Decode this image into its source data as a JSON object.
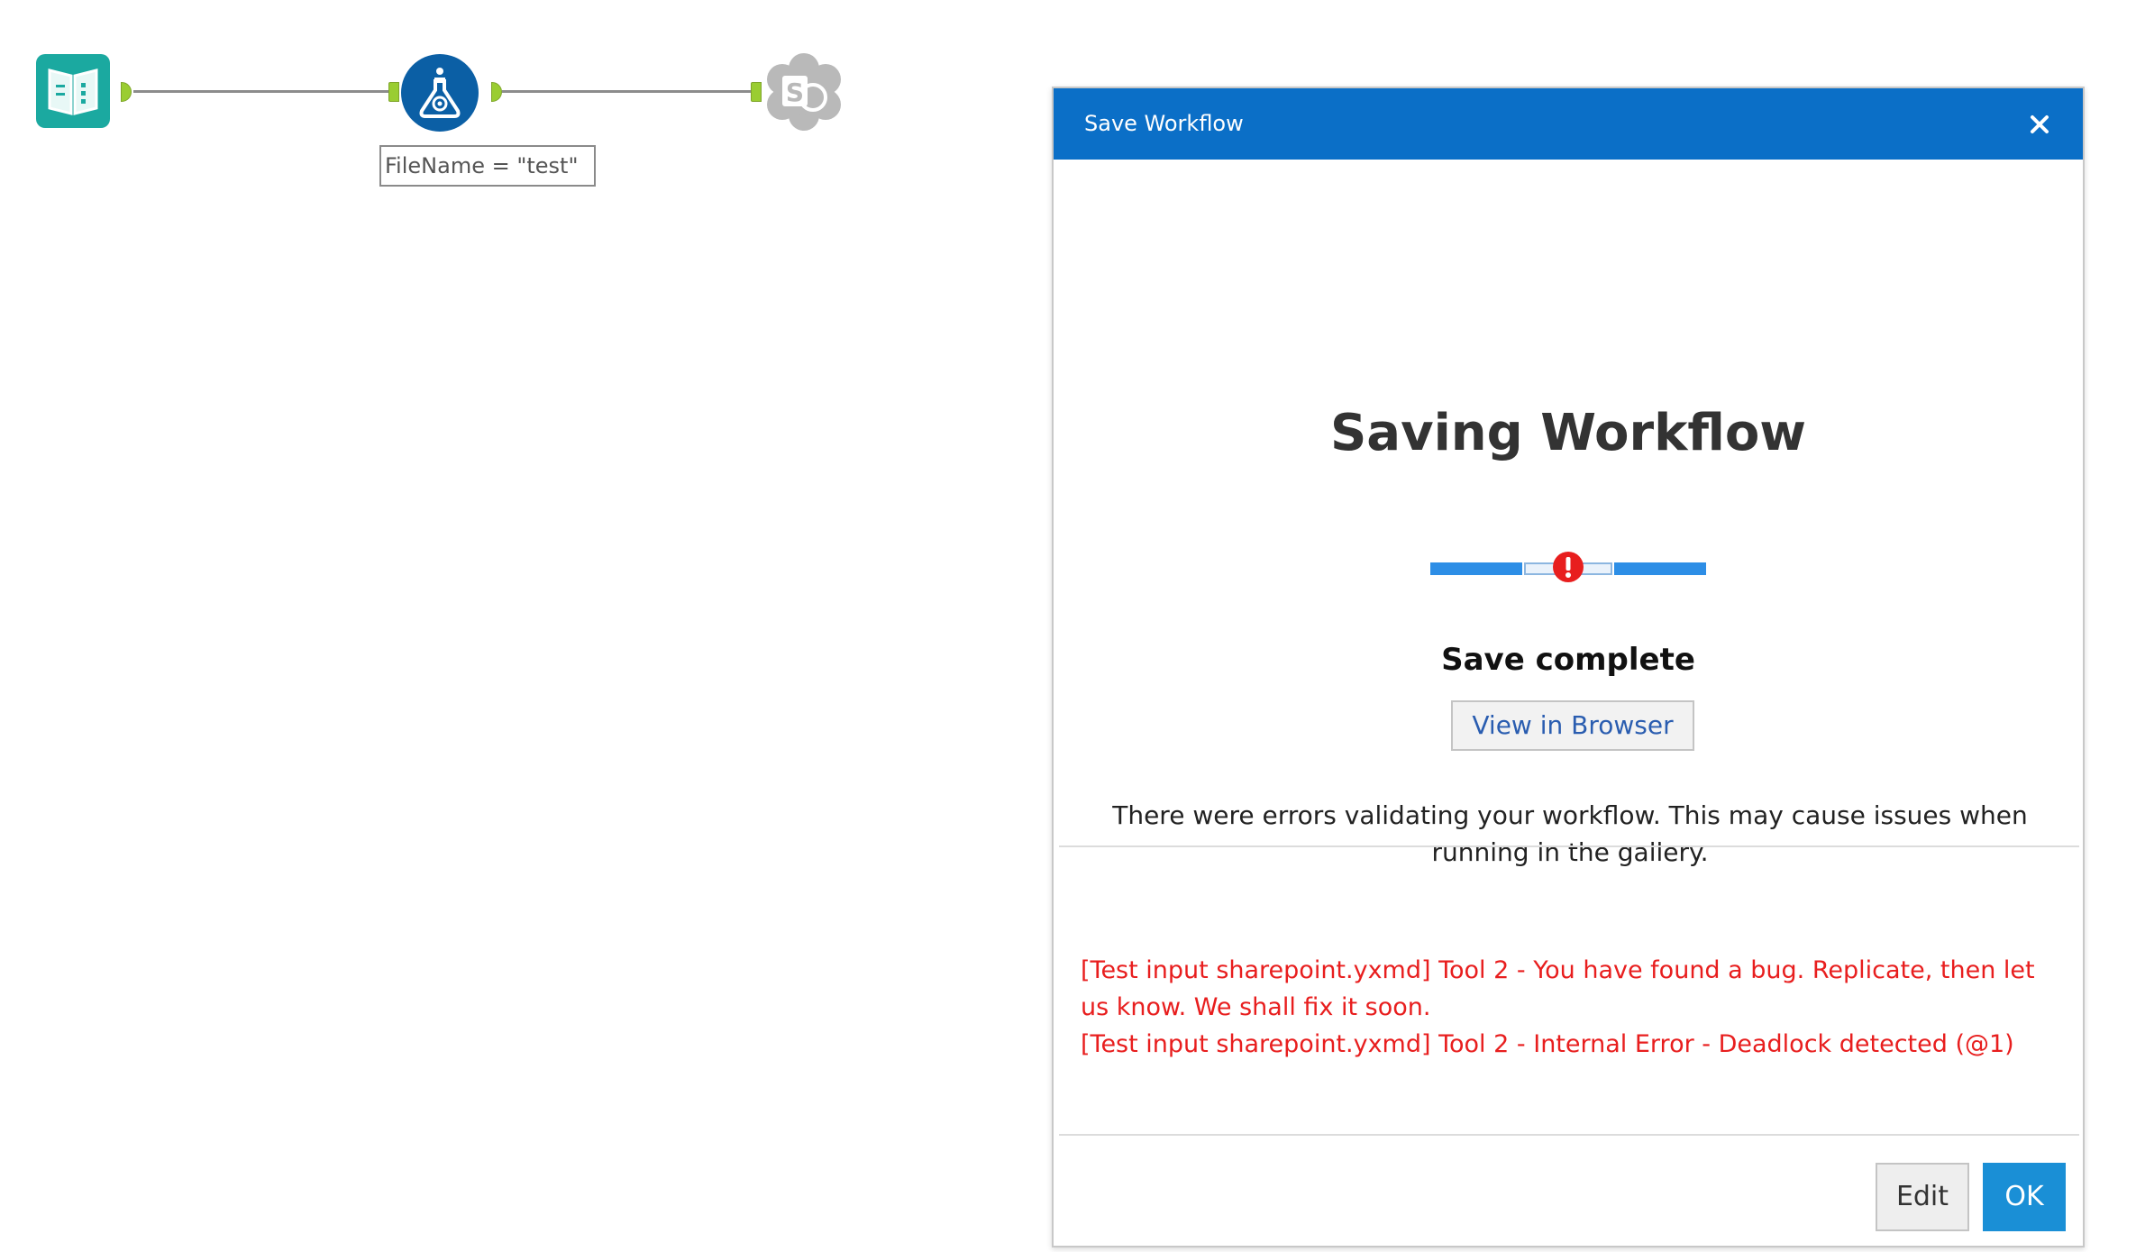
{
  "canvas": {
    "tools": [
      {
        "name": "input-data-tool",
        "icon": "book-icon",
        "color": "#1ba9a0"
      },
      {
        "name": "formula-tool",
        "icon": "flask-icon",
        "color": "#0b5fa5"
      },
      {
        "name": "sharepoint-output-tool",
        "icon": "sharepoint-icon",
        "color": "#b5b5b5"
      }
    ],
    "annotation": "FileName = \"test\"",
    "anchor_color": "#9acd32"
  },
  "dialog": {
    "title": "Save Workflow",
    "close_icon": "close-icon",
    "heading": "Saving Workflow",
    "progress": {
      "steps_total": 4,
      "steps_filled": [
        true,
        false,
        false,
        true
      ],
      "error_step": 2,
      "error_icon": "exclamation-icon",
      "error_color": "#e81e1e"
    },
    "status": "Save complete",
    "view_in_browser_label": "View in Browser",
    "message": "There were errors validating your workflow. This may cause issues when running in the gallery.",
    "errors": [
      "[Test input sharepoint.yxmd] Tool 2 - You have found a bug. Replicate, then let us know. We shall fix it soon.",
      "[Test input sharepoint.yxmd] Tool 2 - Internal Error - Deadlock detected (@1)"
    ],
    "edit_label": "Edit",
    "ok_label": "OK",
    "titlebar_color": "#0b6fc7",
    "ok_color": "#1a8fd6"
  }
}
